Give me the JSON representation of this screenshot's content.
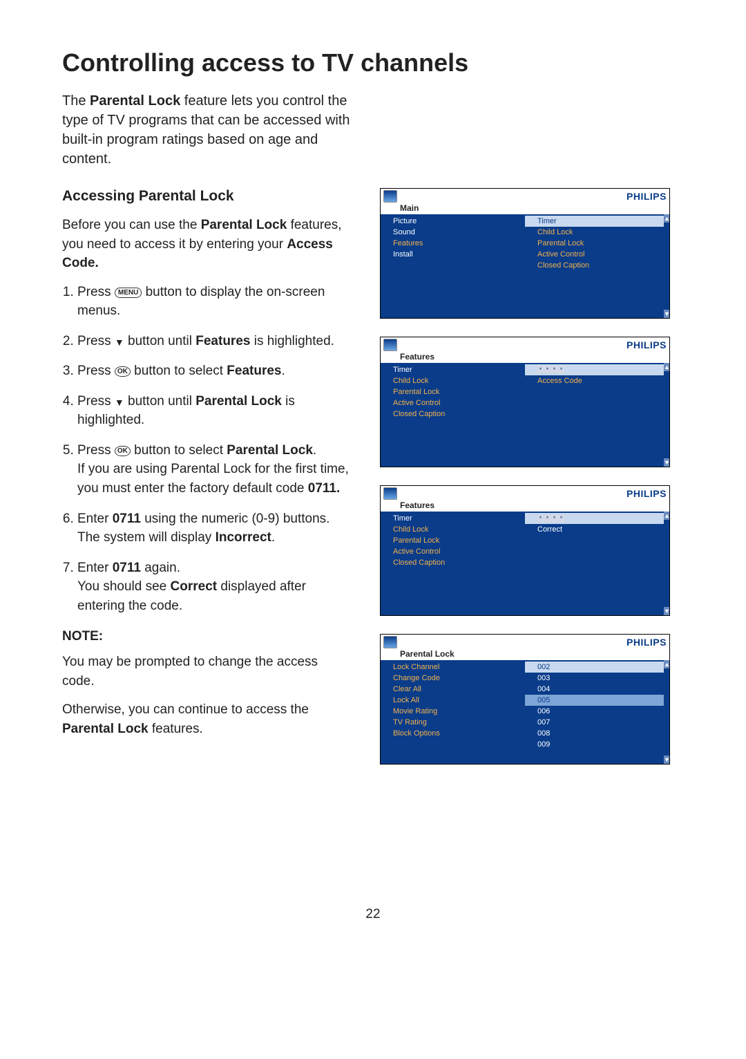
{
  "heading": "Controlling access to TV channels",
  "intro_pre": "The ",
  "intro_bold": "Parental Lock",
  "intro_post": " feature lets you control the type of TV programs that can be accessed with built-in program ratings based on age and content.",
  "sub": "Accessing Parental Lock",
  "p1a": "Before you can use the ",
  "p1b": "Parental Lock",
  "p1c": " features, you need to access it by entering your ",
  "p1d": "Access Code.",
  "btn_menu": "MENU",
  "btn_ok": "OK",
  "s1a": "Press ",
  "s1b": " button to display the on-screen menus.",
  "s2a": "Press ",
  "s2b": " button until ",
  "s2bold": "Features",
  "s2c": " is highlighted.",
  "s3a": "Press ",
  "s3b": " button to select ",
  "s3bold": "Features",
  "s3c": ".",
  "s4a": "Press ",
  "s4b": " button until ",
  "s4bold": "Parental Lock",
  "s4c": " is highlighted.",
  "s5a": "Press ",
  "s5b": " button to select ",
  "s5bold": "Parental Lock",
  "s5c": ".",
  "s5p2a": "If you are using Parental Lock for the first time, you must enter the factory default code ",
  "s5p2b": "0711.",
  "s6a": "Enter ",
  "s6bold": "0711",
  "s6b": " using the numeric (0-9) buttons.",
  "s6p2a": "The system will display ",
  "s6p2b": "Incorrect",
  "s6p2c": ".",
  "s7a": "Enter ",
  "s7bold": "0711",
  "s7b": " again.",
  "s7p2a": "You should see ",
  "s7p2b": "Correct",
  "s7p2c": " displayed after entering the code.",
  "note_label": "NOTE:",
  "note1": "You may be prompted to change the access code.",
  "note2a": "Otherwise, you can continue to access the ",
  "note2b": "Parental Lock",
  "note2c": " features.",
  "brand": "PHILIPS",
  "shot1": {
    "title": "Main",
    "left": [
      "Picture",
      "Sound",
      "Features",
      "Install"
    ],
    "left_hl": "Features",
    "right": [
      "Timer",
      "Child Lock",
      "Parental Lock",
      "Active Control",
      "Closed Caption"
    ]
  },
  "shot2": {
    "title": "Features",
    "left": [
      "Timer",
      "Child Lock",
      "Parental Lock",
      "Active Control",
      "Closed Caption"
    ],
    "right_code_label": "Access Code",
    "code": [
      "*",
      "*",
      "*",
      "*"
    ]
  },
  "shot3": {
    "title": "Features",
    "left": [
      "Timer",
      "Child Lock",
      "Parental Lock",
      "Active Control",
      "Closed Caption"
    ],
    "right_label": "Correct",
    "code": [
      "*",
      "*",
      "*",
      "*"
    ]
  },
  "shot4": {
    "title": "Parental Lock",
    "left": [
      "Lock Channel",
      "Change Code",
      "Clear All",
      "Lock All",
      "Movie Rating",
      "TV Rating",
      "Block Options"
    ],
    "right": [
      "002",
      "003",
      "004",
      "005",
      "006",
      "007",
      "008",
      "009"
    ],
    "right_sel": "005"
  },
  "page": "22"
}
